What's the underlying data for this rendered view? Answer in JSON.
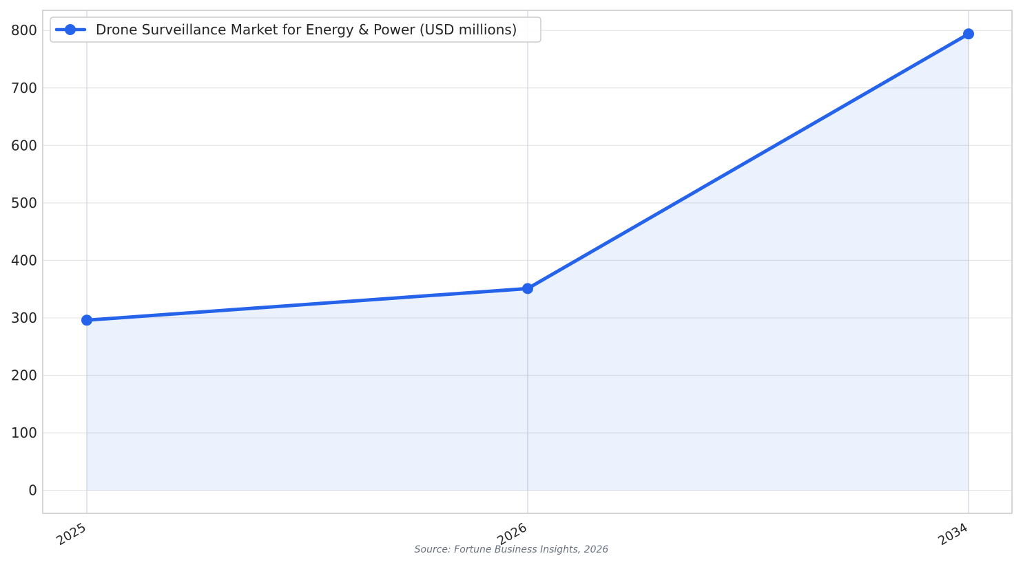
{
  "chart_data": {
    "type": "line",
    "title": "",
    "xlabel": "",
    "ylabel": "",
    "categories": [
      "2025",
      "2026",
      "2034"
    ],
    "series": [
      {
        "name": "Drone Surveillance Market for Energy & Power (USD millions)",
        "values": [
          296,
          351,
          794
        ]
      }
    ],
    "ylim": [
      -40,
      835
    ],
    "yticks": [
      0,
      100,
      200,
      300,
      400,
      500,
      600,
      700,
      800
    ],
    "grid": true,
    "area_fill": true,
    "legend_position": "top-left",
    "colors": {
      "line": "#2563eb",
      "fill": "#2563eb",
      "grid": "#e6e6e6"
    }
  },
  "source_note": "Source: Fortune Business Insights, 2026"
}
